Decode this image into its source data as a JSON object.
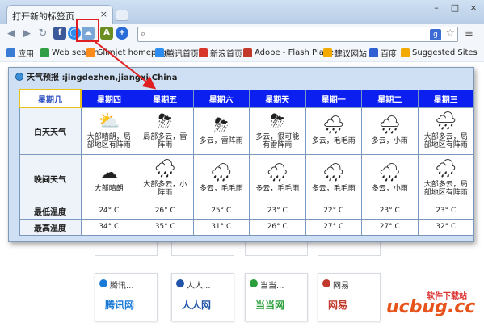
{
  "browser": {
    "tab_title": "打开新的标签页",
    "tab_close": "×",
    "window_controls": [
      "–",
      "□",
      "×"
    ],
    "omnibox_value": "",
    "bookmarks": [
      {
        "label": "应用",
        "color": "#3a7bd5"
      },
      {
        "label": "Web search",
        "color": "#2f9e44"
      },
      {
        "label": "Slimjet homepage",
        "color": "#ff8c1a"
      },
      {
        "label": "腾讯首页",
        "color": "#2d8cf0"
      },
      {
        "label": "新浪首页",
        "color": "#d9362b"
      },
      {
        "label": "Adobe - Flash Player",
        "color": "#c0392b"
      },
      {
        "label": "建议网站",
        "color": "#f2a900"
      },
      {
        "label": "百度",
        "color": "#2f5fd0"
      },
      {
        "label": "Suggested Sites",
        "color": "#f2a900"
      }
    ]
  },
  "popup": {
    "title": "天气预报 :jingdezhen,jiangxi,China",
    "header": [
      "星期几",
      "星期四",
      "星期五",
      "星期六",
      "星期天",
      "星期一",
      "星期二",
      "星期三"
    ],
    "rows": {
      "day_label": "白天天气",
      "night_label": "晚间天气",
      "low_label": "最低温度",
      "high_label": "最高温度"
    },
    "day": [
      {
        "icon": "sun-cloud-rain-icon",
        "glyph": "⛅",
        "text": "大部晴朗，局部地区有阵雨"
      },
      {
        "icon": "thunder-rain-icon",
        "glyph": "⛈",
        "text": "局部多云，雷阵雨"
      },
      {
        "icon": "thunder-rain-icon",
        "glyph": "⛈",
        "text": "多云，雷阵雨"
      },
      {
        "icon": "thunder-rain-icon",
        "glyph": "⛈",
        "text": "多云，很可能有雷阵雨"
      },
      {
        "icon": "drizzle-icon",
        "glyph": "🌧",
        "text": "多云，毛毛雨"
      },
      {
        "icon": "rain-icon",
        "glyph": "🌧",
        "text": "多云，小雨"
      },
      {
        "icon": "rain-icon",
        "glyph": "🌧",
        "text": "大部多云，局部地区有阵雨"
      }
    ],
    "night": [
      {
        "icon": "cloudy-moon-icon",
        "glyph": "☁",
        "text": "大部晴朗"
      },
      {
        "icon": "rain-icon",
        "glyph": "🌧",
        "text": "大部多云，小阵雨"
      },
      {
        "icon": "drizzle-icon",
        "glyph": "🌧",
        "text": "多云，毛毛雨"
      },
      {
        "icon": "drizzle-icon",
        "glyph": "🌧",
        "text": "多云，毛毛雨"
      },
      {
        "icon": "drizzle-icon",
        "glyph": "🌧",
        "text": "多云，毛毛雨"
      },
      {
        "icon": "rain-icon",
        "glyph": "🌧",
        "text": "多云，小雨"
      },
      {
        "icon": "rain-icon",
        "glyph": "🌧",
        "text": "大部多云，局部地区有阵雨"
      }
    ],
    "low": [
      "24° C",
      "26° C",
      "25° C",
      "23° C",
      "22° C",
      "23° C",
      "23° C"
    ],
    "high": [
      "34° C",
      "35° C",
      "31° C",
      "26° C",
      "27° C",
      "27° C",
      "32° C"
    ]
  },
  "tiles": [
    {
      "name": "腾讯...",
      "logo": "腾讯网",
      "color": "#1a7ad8"
    },
    {
      "name": "人人...",
      "logo": "人人网",
      "color": "#2255aa"
    },
    {
      "name": "当当...",
      "logo": "当当网",
      "color": "#2a9e3a"
    },
    {
      "name": "网易",
      "logo": "网易",
      "color": "#c0392b"
    }
  ],
  "watermark": {
    "line1": "软件下载站",
    "line2": "ucbug.cc"
  }
}
